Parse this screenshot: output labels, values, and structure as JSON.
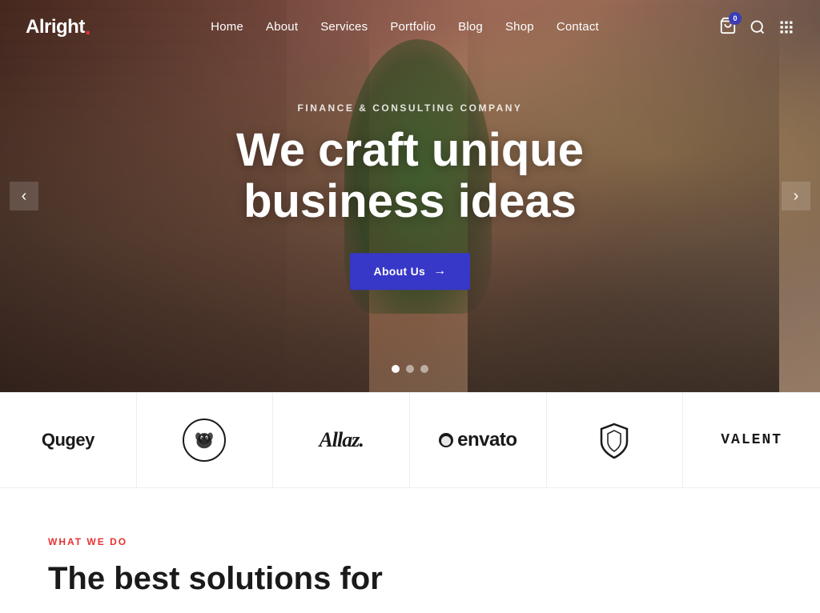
{
  "logo": {
    "text": "Alright",
    "dot": "."
  },
  "nav": {
    "items": [
      {
        "label": "Home",
        "href": "#"
      },
      {
        "label": "About",
        "href": "#"
      },
      {
        "label": "Services",
        "href": "#"
      },
      {
        "label": "Portfolio",
        "href": "#"
      },
      {
        "label": "Blog",
        "href": "#"
      },
      {
        "label": "Shop",
        "href": "#"
      },
      {
        "label": "Contact",
        "href": "#"
      }
    ]
  },
  "cart": {
    "count": "0"
  },
  "hero": {
    "subtitle": "Finance & Consulting Company",
    "title_line1": "We craft unique",
    "title_line2": "business ideas",
    "cta_label": "About Us",
    "dots": [
      {
        "active": true
      },
      {
        "active": false
      },
      {
        "active": false
      }
    ]
  },
  "brands": [
    {
      "name": "Qugey",
      "type": "text"
    },
    {
      "name": "Bulldog",
      "type": "bulldog"
    },
    {
      "name": "Allaz.",
      "type": "text"
    },
    {
      "name": "envato",
      "type": "envato"
    },
    {
      "name": "shield",
      "type": "shield"
    },
    {
      "name": "VALENT",
      "type": "caps"
    }
  ],
  "bottom": {
    "tag": "What We Do",
    "title": "The best solutions for"
  },
  "arrows": {
    "left": "‹",
    "right": "›"
  }
}
